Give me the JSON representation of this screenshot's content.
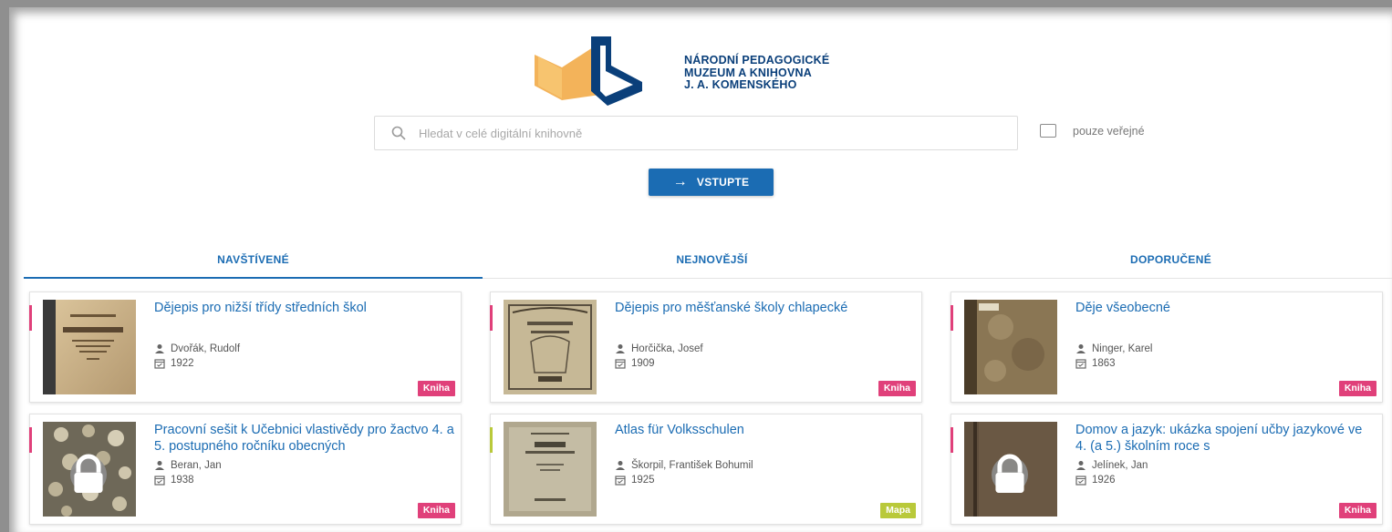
{
  "logo": {
    "lines": [
      "NÁRODNÍ PEDAGOGICKÉ",
      "MUZEUM A KNIHOVNA",
      "J. A. KOMENSKÉHO"
    ],
    "colors": {
      "book_orange": "#f3b35a",
      "book_blue": "#0a3f7a"
    }
  },
  "search": {
    "placeholder": "Hledat v celé digitální knihovně",
    "value": "",
    "icon": "search-icon"
  },
  "public_filter": {
    "label": "pouze veřejné",
    "checked": false
  },
  "enter_button": {
    "label": "VSTUPTE",
    "icon": "arrow-right-icon"
  },
  "tabs": [
    {
      "label": "NAVŠTÍVENÉ",
      "active": true
    },
    {
      "label": "NEJNOVĚJŠÍ",
      "active": false
    },
    {
      "label": "DOPORUČENÉ",
      "active": false
    }
  ],
  "colors": {
    "accent_blue": "#1b6cb3",
    "badge_kniha": "#e0407a",
    "badge_mapa": "#b9c93a"
  },
  "cards": [
    {
      "title": "Dějepis pro nižší třídy středních škol",
      "author": "Dvořák, Rudolf",
      "year": "1922",
      "type": "Kniha",
      "locked": false
    },
    {
      "title": "Dějepis pro měšťanské školy chlapecké",
      "author": "Horčička, Josef",
      "year": "1909",
      "type": "Kniha",
      "locked": false
    },
    {
      "title": "Děje všeobecné",
      "author": "Ninger, Karel",
      "year": "1863",
      "type": "Kniha",
      "locked": false
    },
    {
      "title": "Pracovní sešit k Učebnici vlastivědy pro žactvo 4. a 5. postupného ročníku obecných",
      "author": "Beran, Jan",
      "year": "1938",
      "type": "Kniha",
      "locked": true
    },
    {
      "title": "Atlas für Volksschulen",
      "author": "Škorpil, František Bohumil",
      "year": "1925",
      "type": "Mapa",
      "locked": false
    },
    {
      "title": "Domov a jazyk: ukázka spojení učby jazykové ve 4. (a 5.) školním roce s",
      "author": "Jelínek, Jan",
      "year": "1926",
      "type": "Kniha",
      "locked": true
    }
  ]
}
